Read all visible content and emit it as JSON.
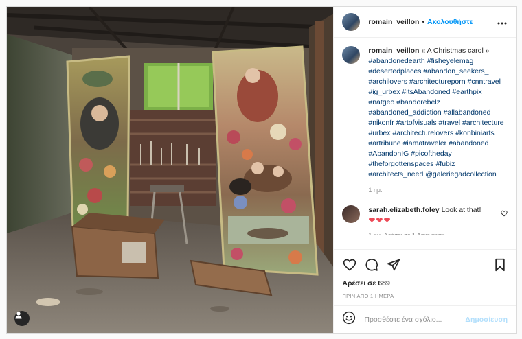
{
  "post": {
    "username": "romain_veillon",
    "follow_label": "Ακολουθήστε",
    "separator": "•",
    "caption_title": " « A Christmas carol »",
    "hashtags": [
      "#abandonedearth",
      "#fisheyelemag",
      "#desertedplaces",
      "#abandon_seekers_",
      "#archilovers",
      "#architectureporn",
      "#cnntravel",
      "#ig_urbex",
      "#itsAbandoned",
      "#earthpix",
      "#natgeo",
      "#bandorebelz",
      "#abandoned_addiction",
      "#allabandoned",
      "#nikonfr",
      "#artofvisuals",
      "#travel",
      "#architecture",
      "#urbex",
      "#architecturelovers",
      "#konbiniarts",
      "#artribune",
      "#iamatraveler",
      "#abandoned",
      "#AbandonIG",
      "#picoftheday",
      "#theforgottenspaces",
      "#fubiz",
      "#architects_need",
      "@galeriegadcollection"
    ],
    "caption_time": "1 ημ.",
    "likes": "Αρέσει σε 689",
    "post_time": "ΠΡΙΝ ΑΠΟ 1 ΗΜΕΡΑ"
  },
  "comment": {
    "username": "sarah.elizabeth.foley",
    "text": " Look at that!",
    "hearts": "❤❤❤",
    "meta": "1 ημ.    Αρέσει σε 1    Απάντηση"
  },
  "add_comment": {
    "placeholder": "Προσθέστε ένα σχόλιο...",
    "post_label": "Δημοσίευση"
  },
  "colors": {
    "link": "#0095f6",
    "hashtag": "#00376b",
    "heart": "#ed4956"
  },
  "icons": [
    "more-options-icon",
    "like-icon",
    "comment-icon",
    "share-icon",
    "save-icon",
    "emoji-icon",
    "user-tag-icon",
    "small-heart-icon"
  ]
}
